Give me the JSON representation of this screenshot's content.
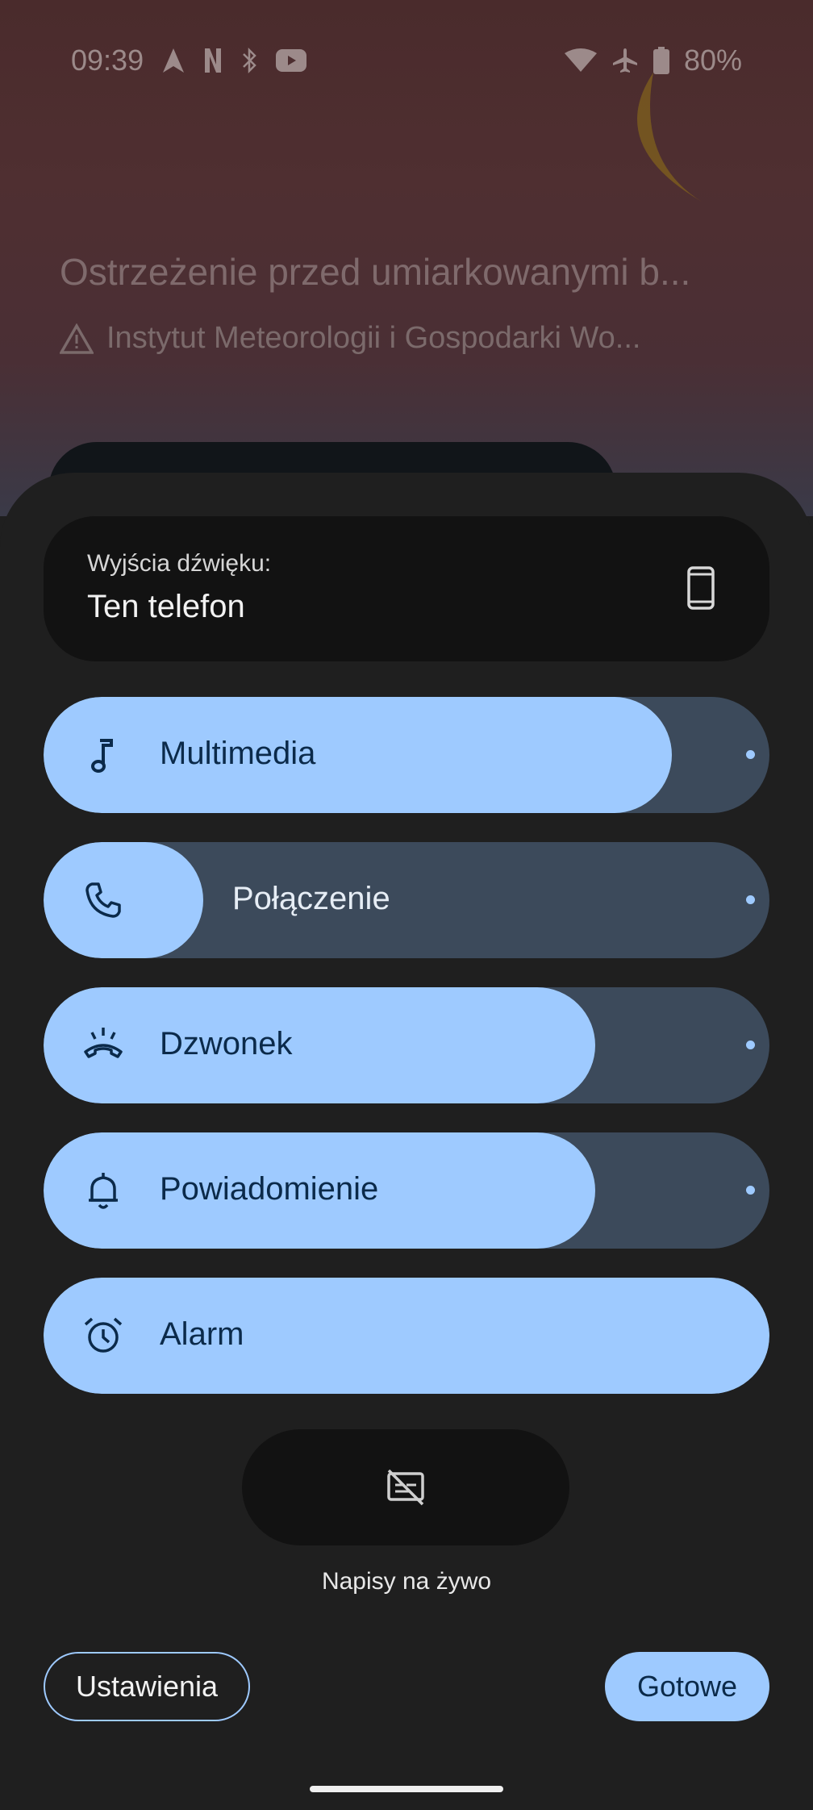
{
  "status": {
    "time": "09:39",
    "battery": "80%",
    "left_icons": [
      "navigation-icon",
      "netflix-icon",
      "bluetooth-icon",
      "youtube-icon"
    ],
    "right_icons": [
      "wifi-icon",
      "airplane-icon",
      "battery-icon"
    ]
  },
  "alert": {
    "title": "Ostrzeżenie przed umiarkowanymi b...",
    "source": "Instytut Meteorologii i Gospodarki Wo..."
  },
  "output": {
    "label": "Wyjścia dźwięku:",
    "value": "Ten telefon"
  },
  "sliders": [
    {
      "name": "Multimedia",
      "icon": "music-note-icon",
      "level": 0.865
    },
    {
      "name": "Połączenie",
      "icon": "phone-icon",
      "level": 0.22
    },
    {
      "name": "Dzwonek",
      "icon": "ringer-icon",
      "level": 0.76
    },
    {
      "name": "Powiadomienie",
      "icon": "bell-icon",
      "level": 0.76
    },
    {
      "name": "Alarm",
      "icon": "alarm-icon",
      "level": 1.0
    }
  ],
  "captions": {
    "label": "Napisy na żywo"
  },
  "buttons": {
    "settings": "Ustawienia",
    "done": "Gotowe"
  },
  "colors": {
    "accent": "#9ecaff",
    "track": "#3c4a5b",
    "panel": "#1f1f1f",
    "card": "#121212"
  }
}
